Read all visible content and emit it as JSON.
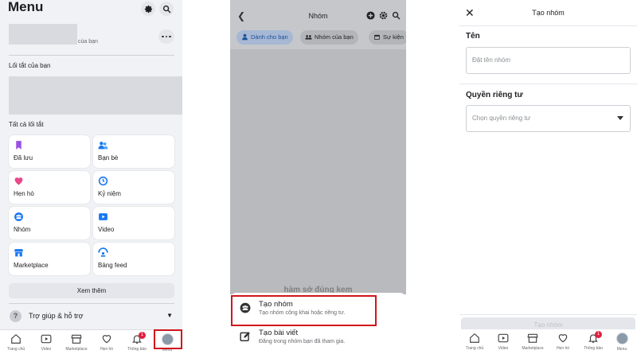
{
  "panel1": {
    "title": "Menu",
    "profile_subtitle": "cùa bạn",
    "shortcuts_label": "Lối tắt của bạn",
    "all_shortcuts_label": "Tất cả lối tắt",
    "tiles": [
      {
        "label": "Đã lưu",
        "icon": "bookmark-icon"
      },
      {
        "label": "Bạn bè",
        "icon": "friends-icon"
      },
      {
        "label": "Hẹn hò",
        "icon": "heart-icon"
      },
      {
        "label": "Kỷ niệm",
        "icon": "clock-icon"
      },
      {
        "label": "Nhóm",
        "icon": "groups-icon"
      },
      {
        "label": "Video",
        "icon": "video-icon"
      },
      {
        "label": "Marketplace",
        "icon": "shop-icon"
      },
      {
        "label": "Bảng feed",
        "icon": "feed-icon"
      }
    ],
    "see_more": "Xem thêm",
    "help_label": "Trợ giúp & hỗ trợ"
  },
  "bottom_nav": {
    "items": [
      "Trang chủ",
      "Video",
      "Marketplace",
      "Hẹn hò",
      "Thông báo",
      "Menu"
    ],
    "notification_count": "1"
  },
  "panel2": {
    "title": "Nhóm",
    "chips": [
      "Dành cho bạn",
      "Nhóm của bạn",
      "Sự kiện"
    ],
    "cutoff_text": "hàm sở đúng kem",
    "create_group": {
      "title": "Tạo nhóm",
      "subtitle": "Tạo nhóm công khai hoặc riêng tư."
    },
    "create_post": {
      "title": "Tạo bài viết",
      "subtitle": "Đăng trong nhóm bạn đã tham gia."
    }
  },
  "panel3": {
    "title": "Tạo nhóm",
    "name_label": "Tên",
    "name_placeholder": "Đặt tên nhóm",
    "privacy_label": "Quyền riêng tư",
    "privacy_placeholder": "Chọn quyền riêng tư",
    "submit": "Tạo nhóm"
  },
  "colors": {
    "accent_red": "#d0161c",
    "brand_blue": "#1877f2",
    "badge_red": "#e41e3f"
  }
}
